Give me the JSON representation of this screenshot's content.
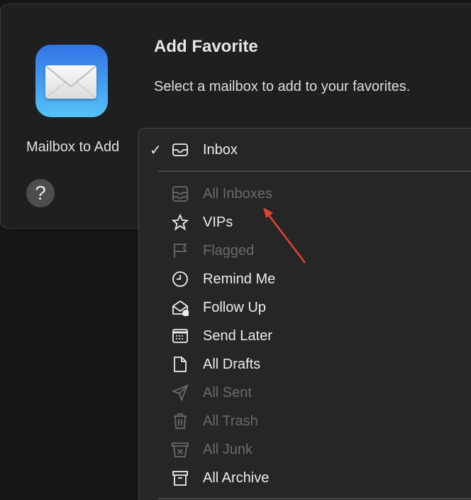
{
  "dialog": {
    "title": "Add Favorite",
    "subtitle": "Select a mailbox to add to your favorites.",
    "field_label": "Mailbox to Add",
    "help_label": "?"
  },
  "menu": {
    "selected": "Inbox",
    "check": "✓",
    "items": [
      {
        "label": "Inbox",
        "icon": "inbox-icon",
        "enabled": true
      },
      {
        "label": "All Inboxes",
        "icon": "all-inboxes-icon",
        "enabled": false
      },
      {
        "label": "VIPs",
        "icon": "star-icon",
        "enabled": true
      },
      {
        "label": "Flagged",
        "icon": "flag-icon",
        "enabled": false
      },
      {
        "label": "Remind Me",
        "icon": "clock-icon",
        "enabled": true
      },
      {
        "label": "Follow Up",
        "icon": "envelope-clock-icon",
        "enabled": true
      },
      {
        "label": "Send Later",
        "icon": "calendar-icon",
        "enabled": true
      },
      {
        "label": "All Drafts",
        "icon": "document-icon",
        "enabled": true
      },
      {
        "label": "All Sent",
        "icon": "paper-plane-icon",
        "enabled": false
      },
      {
        "label": "All Trash",
        "icon": "trash-icon",
        "enabled": false
      },
      {
        "label": "All Junk",
        "icon": "junk-icon",
        "enabled": false
      },
      {
        "label": "All Archive",
        "icon": "archive-icon",
        "enabled": true
      }
    ]
  },
  "colors": {
    "annotation_arrow": "#e0442e",
    "app_icon_top": "#3273e6",
    "app_icon_bottom": "#55c3f8"
  }
}
